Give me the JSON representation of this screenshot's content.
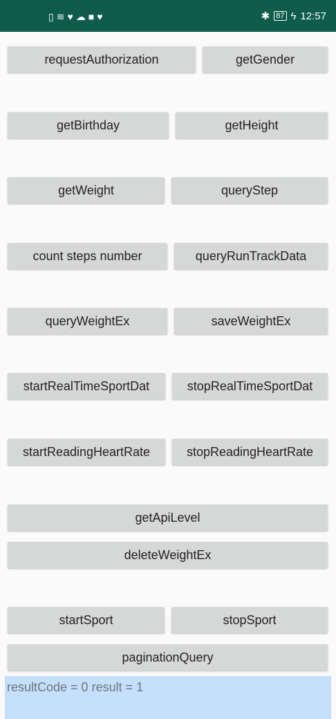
{
  "status_bar": {
    "left_icons": [
      "sim-icon",
      "wifi-icon",
      "heart-icon",
      "cloud-icon",
      "app-icon",
      "heart-icon"
    ],
    "bluetooth_icon": "bluetooth-icon",
    "battery": "87",
    "charging_icon": "charging-icon",
    "time": "12:57"
  },
  "buttons": {
    "request_authorization": "requestAuthorization",
    "get_gender": "getGender",
    "get_birthday": "getBirthday",
    "get_height": "getHeight",
    "get_weight": "getWeight",
    "query_step": "queryStep",
    "count_steps_number": "count steps number",
    "query_run_track_data": "queryRunTrackData",
    "query_weight_ex": "queryWeightEx",
    "save_weight_ex": "saveWeightEx",
    "start_real_time_sport_data": "startRealTimeSportDat",
    "stop_real_time_sport_data": "stopRealTimeSportDat",
    "start_reading_heart_rate": "startReadingHeartRate",
    "stop_reading_heart_rate": "stopReadingHeartRate",
    "get_api_level": "getApiLevel",
    "delete_weight_ex": "deleteWeightEx",
    "start_sport": "startSport",
    "stop_sport": "stopSport",
    "pagination_query": "paginationQuery"
  },
  "result_text": "resultCode = 0 result = 1"
}
